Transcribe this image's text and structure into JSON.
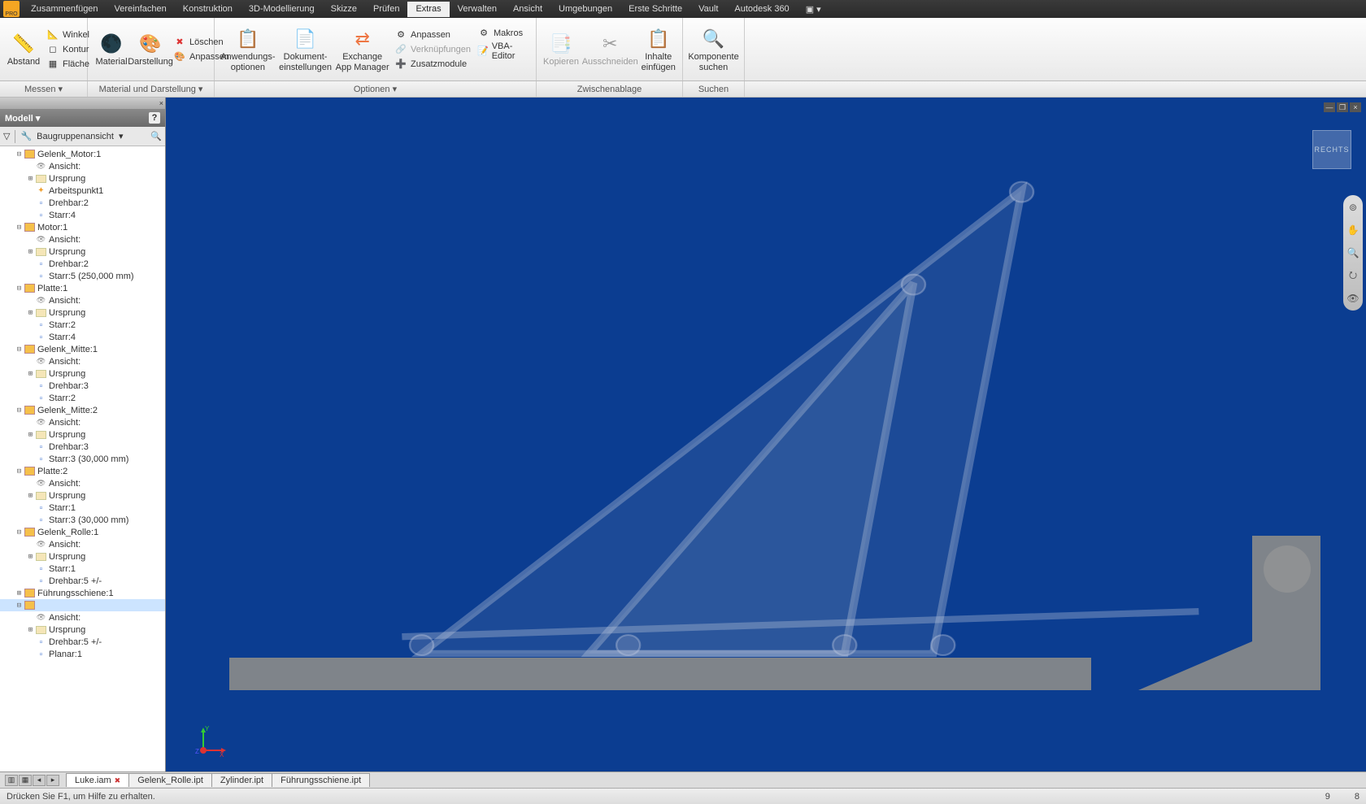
{
  "menu": [
    "Zusammenfügen",
    "Vereinfachen",
    "Konstruktion",
    "3D-Modellierung",
    "Skizze",
    "Prüfen",
    "Extras",
    "Verwalten",
    "Ansicht",
    "Umgebungen",
    "Erste Schritte",
    "Vault",
    "Autodesk 360"
  ],
  "menu_active": 6,
  "ribbon": {
    "g1": {
      "abstand": "Abstand",
      "winkel": "Winkel",
      "kontur": "Kontur",
      "flache": "Fläche"
    },
    "g2": {
      "material": "Material",
      "darstellung": "Darstellung",
      "loeschen": "Löschen",
      "anpassen": "Anpassen"
    },
    "g3": {
      "anw": "Anwendungs-\noptionen",
      "dok": "Dokument-\neinstellungen",
      "exch": "Exchange\nApp Manager",
      "anp": "Anpassen",
      "verk": "Verknüpfungen",
      "vba": "VBA-Editor",
      "zus": "Zusatzmodule",
      "makros": "Makros"
    },
    "g4": {
      "kop": "Kopieren",
      "aus": "Ausschneiden",
      "ein": "Inhalte\neinfügen"
    },
    "g5": {
      "komp": "Komponente\nsuchen"
    }
  },
  "panels": {
    "messen": "Messen",
    "matdar": "Material und Darstellung",
    "optionen": "Optionen",
    "zwisch": "Zwischenablage",
    "suchen": "Suchen"
  },
  "sidebar": {
    "title": "Modell",
    "toolbar": "Baugruppenansicht",
    "tree": [
      {
        "d": 1,
        "t": "asm",
        "exp": "-",
        "label": "Gelenk_Motor:1"
      },
      {
        "d": 2,
        "t": "view",
        "exp": "",
        "label": "Ansicht:"
      },
      {
        "d": 2,
        "t": "fold",
        "exp": "+",
        "label": "Ursprung"
      },
      {
        "d": 2,
        "t": "wp",
        "exp": "",
        "label": "Arbeitspunkt1"
      },
      {
        "d": 2,
        "t": "const",
        "exp": "",
        "label": "Drehbar:2"
      },
      {
        "d": 2,
        "t": "const",
        "exp": "",
        "label": "Starr:4"
      },
      {
        "d": 1,
        "t": "asm",
        "exp": "-",
        "label": "Motor:1"
      },
      {
        "d": 2,
        "t": "view",
        "exp": "",
        "label": "Ansicht:"
      },
      {
        "d": 2,
        "t": "fold",
        "exp": "+",
        "label": "Ursprung"
      },
      {
        "d": 2,
        "t": "const",
        "exp": "",
        "label": "Drehbar:2"
      },
      {
        "d": 2,
        "t": "const",
        "exp": "",
        "label": "Starr:5 (250,000 mm)"
      },
      {
        "d": 1,
        "t": "asm",
        "exp": "-",
        "label": "Platte:1"
      },
      {
        "d": 2,
        "t": "view",
        "exp": "",
        "label": "Ansicht:"
      },
      {
        "d": 2,
        "t": "fold",
        "exp": "+",
        "label": "Ursprung"
      },
      {
        "d": 2,
        "t": "const",
        "exp": "",
        "label": "Starr:2"
      },
      {
        "d": 2,
        "t": "const",
        "exp": "",
        "label": "Starr:4"
      },
      {
        "d": 1,
        "t": "asm",
        "exp": "-",
        "label": "Gelenk_Mitte:1"
      },
      {
        "d": 2,
        "t": "view",
        "exp": "",
        "label": "Ansicht:"
      },
      {
        "d": 2,
        "t": "fold",
        "exp": "+",
        "label": "Ursprung"
      },
      {
        "d": 2,
        "t": "const",
        "exp": "",
        "label": "Drehbar:3"
      },
      {
        "d": 2,
        "t": "const",
        "exp": "",
        "label": "Starr:2"
      },
      {
        "d": 1,
        "t": "asm",
        "exp": "-",
        "label": "Gelenk_Mitte:2"
      },
      {
        "d": 2,
        "t": "view",
        "exp": "",
        "label": "Ansicht:"
      },
      {
        "d": 2,
        "t": "fold",
        "exp": "+",
        "label": "Ursprung"
      },
      {
        "d": 2,
        "t": "const",
        "exp": "",
        "label": "Drehbar:3"
      },
      {
        "d": 2,
        "t": "const",
        "exp": "",
        "label": "Starr:3 (30,000 mm)"
      },
      {
        "d": 1,
        "t": "asm",
        "exp": "-",
        "label": "Platte:2"
      },
      {
        "d": 2,
        "t": "view",
        "exp": "",
        "label": "Ansicht:"
      },
      {
        "d": 2,
        "t": "fold",
        "exp": "+",
        "label": "Ursprung"
      },
      {
        "d": 2,
        "t": "const",
        "exp": "",
        "label": "Starr:1"
      },
      {
        "d": 2,
        "t": "const",
        "exp": "",
        "label": "Starr:3 (30,000 mm)"
      },
      {
        "d": 1,
        "t": "asm",
        "exp": "-",
        "label": "Gelenk_Rolle:1"
      },
      {
        "d": 2,
        "t": "view",
        "exp": "",
        "label": "Ansicht:"
      },
      {
        "d": 2,
        "t": "fold",
        "exp": "+",
        "label": "Ursprung"
      },
      {
        "d": 2,
        "t": "const",
        "exp": "",
        "label": "Starr:1"
      },
      {
        "d": 2,
        "t": "const",
        "exp": "",
        "label": "Drehbar:5 +/-"
      },
      {
        "d": 1,
        "t": "asm",
        "exp": "+",
        "label": "Führungsschiene:1"
      },
      {
        "d": 1,
        "t": "asm",
        "exp": "-",
        "label": "",
        "sel": true
      },
      {
        "d": 2,
        "t": "view",
        "exp": "",
        "label": "Ansicht:"
      },
      {
        "d": 2,
        "t": "fold",
        "exp": "+",
        "label": "Ursprung"
      },
      {
        "d": 2,
        "t": "const",
        "exp": "",
        "label": "Drehbar:5 +/-"
      },
      {
        "d": 2,
        "t": "const",
        "exp": "",
        "label": "Planar:1"
      }
    ]
  },
  "viewcube": "RECHTS",
  "axis": {
    "x": "X",
    "y": "Y",
    "z": "Z"
  },
  "tabs": [
    "Luke.iam",
    "Gelenk_Rolle.ipt",
    "Zylinder.ipt",
    "Führungsschiene.ipt"
  ],
  "tabs_active": 0,
  "status": {
    "hint": "Drücken Sie F1, um Hilfe zu erhalten.",
    "n1": "9",
    "n2": "8"
  }
}
